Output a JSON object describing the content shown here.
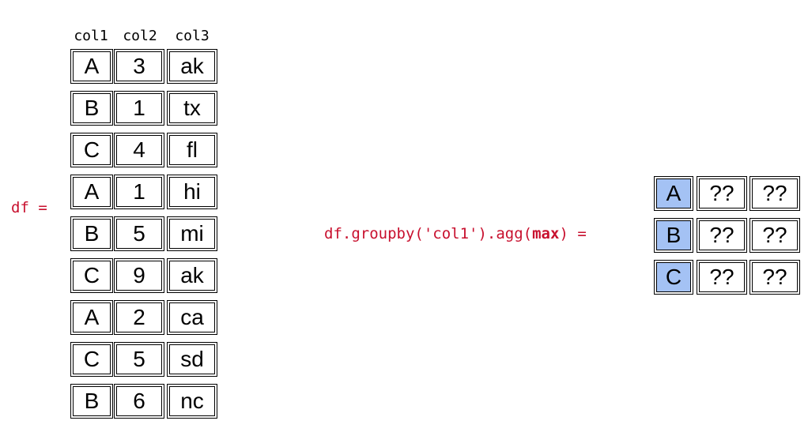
{
  "df_label": "df =",
  "headers": [
    "col1",
    "col2",
    "col3"
  ],
  "rows": [
    [
      "A",
      "3",
      "ak"
    ],
    [
      "B",
      "1",
      "tx"
    ],
    [
      "C",
      "4",
      "fl"
    ],
    [
      "A",
      "1",
      "hi"
    ],
    [
      "B",
      "5",
      "mi"
    ],
    [
      "C",
      "9",
      "ak"
    ],
    [
      "A",
      "2",
      "ca"
    ],
    [
      "C",
      "5",
      "sd"
    ],
    [
      "B",
      "6",
      "nc"
    ]
  ],
  "expression": {
    "prefix": "df.groupby('col1').agg(",
    "func": "max",
    "suffix": ") ="
  },
  "result_rows": [
    [
      "A",
      "??",
      "??"
    ],
    [
      "B",
      "??",
      "??"
    ],
    [
      "C",
      "??",
      "??"
    ]
  ],
  "colors": {
    "key_highlight": "#a4c2f4",
    "code_red": "#c8102e"
  }
}
